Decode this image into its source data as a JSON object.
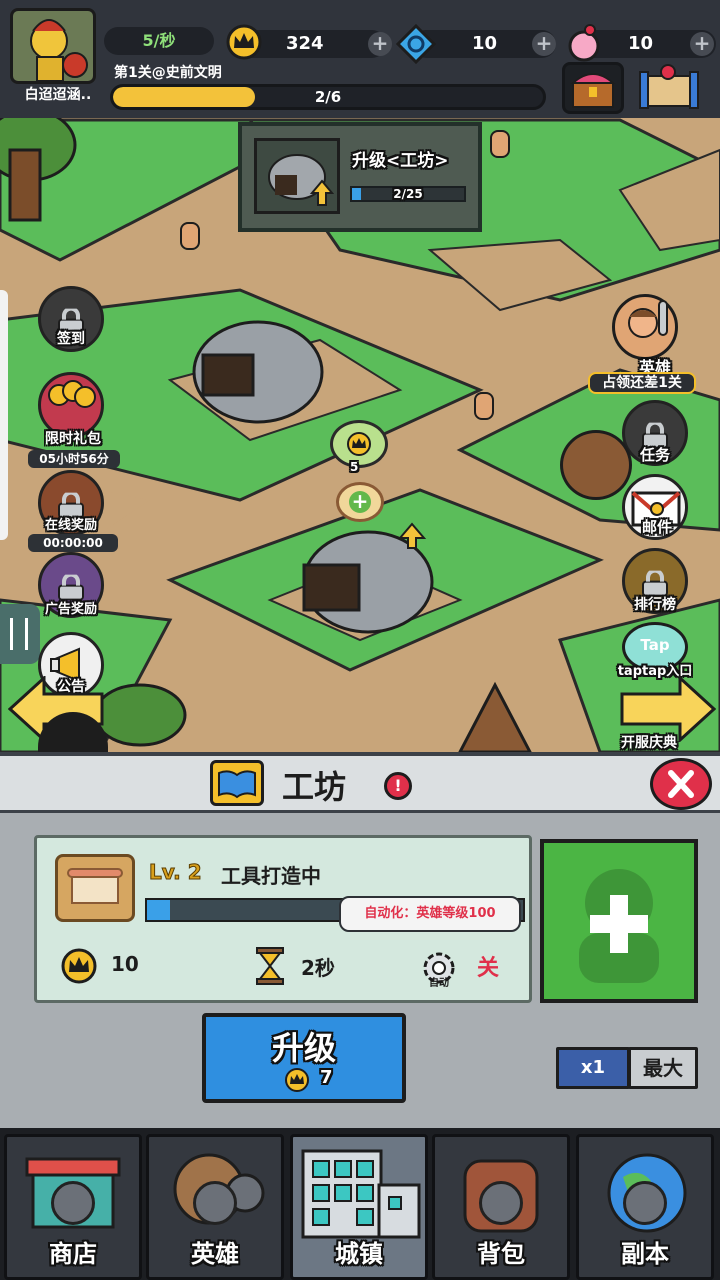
{
  "player": {
    "name": "白迢迢涵..",
    "rate": "5/秒",
    "stage": "第1关@史前文明",
    "progress_text": "2/6",
    "progress": 0.33
  },
  "resources": [
    {
      "icon": "crown-icon",
      "value": "324"
    },
    {
      "icon": "spiral-gem-icon",
      "value": "10"
    },
    {
      "icon": "candy-icon",
      "value": "10"
    }
  ],
  "upgrade_card": {
    "title": "升级<工坊>",
    "progress_text": "2/25",
    "progress": 0.08
  },
  "map": {
    "crown_bubble_count": "5"
  },
  "left_menu": [
    {
      "label": "签到",
      "timer": ""
    },
    {
      "label": "限时礼包",
      "timer": "05小时56分"
    },
    {
      "label": "在线奖励",
      "timer": "00:00:00"
    },
    {
      "label": "广告奖励",
      "timer": ""
    },
    {
      "label": "公告",
      "timer": ""
    }
  ],
  "right_menu": [
    {
      "label": "英雄",
      "sub": "占领还差1关"
    },
    {
      "label": "任务"
    },
    {
      "label": "邮件"
    },
    {
      "label": "排行榜"
    },
    {
      "label": "taptap入口",
      "badge": "Tap"
    },
    {
      "label": "开服庆典"
    }
  ],
  "panel": {
    "title": "工坊",
    "alert": "!",
    "item": {
      "level": "Lv. 2",
      "status": "工具打造中",
      "progress": 0.06
    },
    "tooltip": "自动化：英雄等级100",
    "cost": "10",
    "time": "2秒",
    "auto_label": "自动",
    "auto_state": "关",
    "upgrade": {
      "label": "升级",
      "cost": "7"
    },
    "multiplier": {
      "x1": "x1",
      "max": "最大"
    }
  },
  "nav": [
    {
      "label": "商店",
      "active": false
    },
    {
      "label": "英雄",
      "active": false
    },
    {
      "label": "城镇",
      "active": true
    },
    {
      "label": "背包",
      "active": false
    },
    {
      "label": "副本",
      "active": false
    }
  ],
  "colors": {
    "grass": "#5bbd5a",
    "path": "#c9a677",
    "accent_blue": "#2f8fe0",
    "alert_red": "#e0304a"
  }
}
